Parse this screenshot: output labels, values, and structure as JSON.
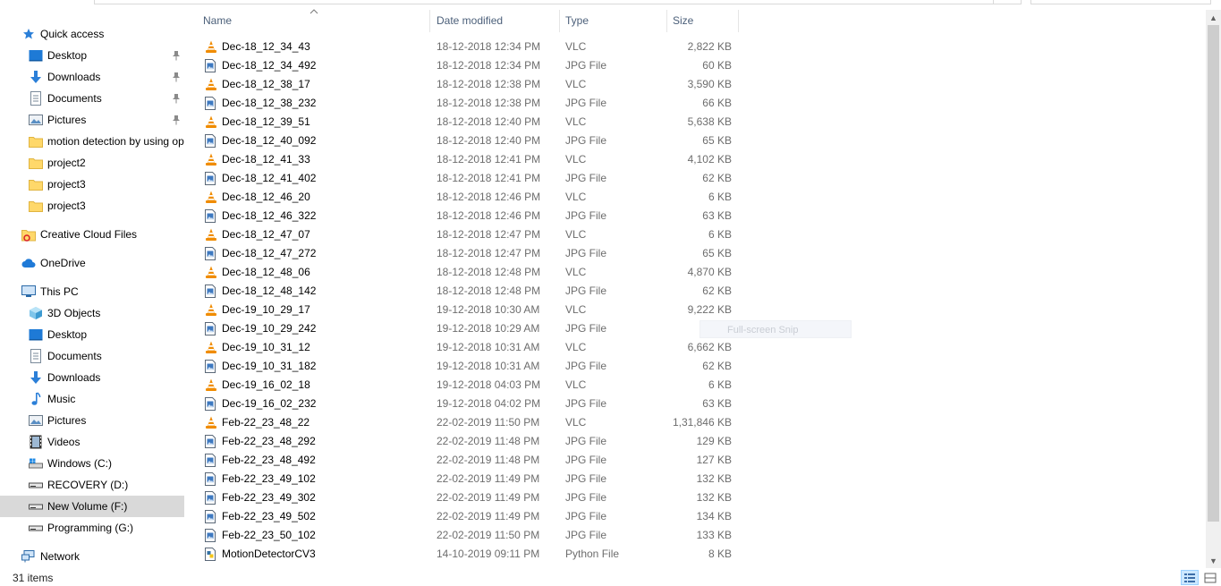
{
  "nav": {
    "items": [
      {
        "label": "Quick access",
        "icon": "star-icon",
        "level": 0
      },
      {
        "label": "Desktop",
        "icon": "desktop-icon",
        "level": 1,
        "pinned": true
      },
      {
        "label": "Downloads",
        "icon": "download-arrow-icon",
        "level": 1,
        "pinned": true
      },
      {
        "label": "Documents",
        "icon": "documents-icon",
        "level": 1,
        "pinned": true
      },
      {
        "label": "Pictures",
        "icon": "pictures-icon",
        "level": 1,
        "pinned": true
      },
      {
        "label": "motion detection by using opencv",
        "icon": "folder-icon",
        "level": 1
      },
      {
        "label": "project2",
        "icon": "folder-icon",
        "level": 1
      },
      {
        "label": "project3",
        "icon": "folder-icon",
        "level": 1
      },
      {
        "label": "project3",
        "icon": "folder-icon",
        "level": 1
      },
      {
        "label": "Creative Cloud Files",
        "icon": "creative-cloud-icon",
        "level": 0
      },
      {
        "label": "OneDrive",
        "icon": "cloud-icon",
        "level": 0
      },
      {
        "label": "This PC",
        "icon": "computer-icon",
        "level": 0
      },
      {
        "label": "3D Objects",
        "icon": "cube-icon",
        "level": 1
      },
      {
        "label": "Desktop",
        "icon": "desktop-icon",
        "level": 1
      },
      {
        "label": "Documents",
        "icon": "documents-icon",
        "level": 1
      },
      {
        "label": "Downloads",
        "icon": "download-arrow-icon",
        "level": 1
      },
      {
        "label": "Music",
        "icon": "music-note-icon",
        "level": 1
      },
      {
        "label": "Pictures",
        "icon": "pictures-icon",
        "level": 1
      },
      {
        "label": "Videos",
        "icon": "film-icon",
        "level": 1
      },
      {
        "label": "Windows (C:)",
        "icon": "windows-drive-icon",
        "level": 1
      },
      {
        "label": "RECOVERY (D:)",
        "icon": "drive-icon",
        "level": 1
      },
      {
        "label": "New Volume (F:)",
        "icon": "drive-icon",
        "level": 1,
        "selected": true
      },
      {
        "label": "Programming (G:)",
        "icon": "drive-icon",
        "level": 1
      },
      {
        "label": "Network",
        "icon": "network-icon",
        "level": 0
      }
    ]
  },
  "columns": {
    "name": "Name",
    "date": "Date modified",
    "type": "Type",
    "size": "Size"
  },
  "files": [
    {
      "name": "Dec-18_12_34_43",
      "date": "18-12-2018 12:34 PM",
      "type": "VLC",
      "size": "2,822 KB",
      "icon": "vlc-cone-icon"
    },
    {
      "name": "Dec-18_12_34_492",
      "date": "18-12-2018 12:34 PM",
      "type": "JPG File",
      "size": "60 KB",
      "icon": "image-file-icon"
    },
    {
      "name": "Dec-18_12_38_17",
      "date": "18-12-2018 12:38 PM",
      "type": "VLC",
      "size": "3,590 KB",
      "icon": "vlc-cone-icon"
    },
    {
      "name": "Dec-18_12_38_232",
      "date": "18-12-2018 12:38 PM",
      "type": "JPG File",
      "size": "66 KB",
      "icon": "image-file-icon"
    },
    {
      "name": "Dec-18_12_39_51",
      "date": "18-12-2018 12:40 PM",
      "type": "VLC",
      "size": "5,638 KB",
      "icon": "vlc-cone-icon"
    },
    {
      "name": "Dec-18_12_40_092",
      "date": "18-12-2018 12:40 PM",
      "type": "JPG File",
      "size": "65 KB",
      "icon": "image-file-icon"
    },
    {
      "name": "Dec-18_12_41_33",
      "date": "18-12-2018 12:41 PM",
      "type": "VLC",
      "size": "4,102 KB",
      "icon": "vlc-cone-icon"
    },
    {
      "name": "Dec-18_12_41_402",
      "date": "18-12-2018 12:41 PM",
      "type": "JPG File",
      "size": "62 KB",
      "icon": "image-file-icon"
    },
    {
      "name": "Dec-18_12_46_20",
      "date": "18-12-2018 12:46 PM",
      "type": "VLC",
      "size": "6 KB",
      "icon": "vlc-cone-icon"
    },
    {
      "name": "Dec-18_12_46_322",
      "date": "18-12-2018 12:46 PM",
      "type": "JPG File",
      "size": "63 KB",
      "icon": "image-file-icon"
    },
    {
      "name": "Dec-18_12_47_07",
      "date": "18-12-2018 12:47 PM",
      "type": "VLC",
      "size": "6 KB",
      "icon": "vlc-cone-icon"
    },
    {
      "name": "Dec-18_12_47_272",
      "date": "18-12-2018 12:47 PM",
      "type": "JPG File",
      "size": "65 KB",
      "icon": "image-file-icon"
    },
    {
      "name": "Dec-18_12_48_06",
      "date": "18-12-2018 12:48 PM",
      "type": "VLC",
      "size": "4,870 KB",
      "icon": "vlc-cone-icon"
    },
    {
      "name": "Dec-18_12_48_142",
      "date": "18-12-2018 12:48 PM",
      "type": "JPG File",
      "size": "62 KB",
      "icon": "image-file-icon"
    },
    {
      "name": "Dec-19_10_29_17",
      "date": "19-12-2018 10:30 AM",
      "type": "VLC",
      "size": "9,222 KB",
      "icon": "vlc-cone-icon"
    },
    {
      "name": "Dec-19_10_29_242",
      "date": "19-12-2018 10:29 AM",
      "type": "JPG File",
      "size": "64 KB",
      "icon": "image-file-icon"
    },
    {
      "name": "Dec-19_10_31_12",
      "date": "19-12-2018 10:31 AM",
      "type": "VLC",
      "size": "6,662 KB",
      "icon": "vlc-cone-icon"
    },
    {
      "name": "Dec-19_10_31_182",
      "date": "19-12-2018 10:31 AM",
      "type": "JPG File",
      "size": "62 KB",
      "icon": "image-file-icon"
    },
    {
      "name": "Dec-19_16_02_18",
      "date": "19-12-2018 04:03 PM",
      "type": "VLC",
      "size": "6 KB",
      "icon": "vlc-cone-icon"
    },
    {
      "name": "Dec-19_16_02_232",
      "date": "19-12-2018 04:02 PM",
      "type": "JPG File",
      "size": "63 KB",
      "icon": "image-file-icon"
    },
    {
      "name": "Feb-22_23_48_22",
      "date": "22-02-2019 11:50 PM",
      "type": "VLC",
      "size": "1,31,846 KB",
      "icon": "vlc-cone-icon"
    },
    {
      "name": "Feb-22_23_48_292",
      "date": "22-02-2019 11:48 PM",
      "type": "JPG File",
      "size": "129 KB",
      "icon": "image-file-icon"
    },
    {
      "name": "Feb-22_23_48_492",
      "date": "22-02-2019 11:48 PM",
      "type": "JPG File",
      "size": "127 KB",
      "icon": "image-file-icon"
    },
    {
      "name": "Feb-22_23_49_102",
      "date": "22-02-2019 11:49 PM",
      "type": "JPG File",
      "size": "132 KB",
      "icon": "image-file-icon"
    },
    {
      "name": "Feb-22_23_49_302",
      "date": "22-02-2019 11:49 PM",
      "type": "JPG File",
      "size": "132 KB",
      "icon": "image-file-icon"
    },
    {
      "name": "Feb-22_23_49_502",
      "date": "22-02-2019 11:49 PM",
      "type": "JPG File",
      "size": "134 KB",
      "icon": "image-file-icon"
    },
    {
      "name": "Feb-22_23_50_102",
      "date": "22-02-2019 11:50 PM",
      "type": "JPG File",
      "size": "133 KB",
      "icon": "image-file-icon"
    },
    {
      "name": "MotionDetectorCV3",
      "date": "14-10-2019 09:11 PM",
      "type": "Python File",
      "size": "8 KB",
      "icon": "python-file-icon"
    }
  ],
  "tooltip_ghost": "Full-screen Snip",
  "status": {
    "item_count": "31 items"
  },
  "colors": {
    "selected_nav": "#d9d9d9",
    "header_text": "#4c607a",
    "detail_text": "#6d6d6d",
    "vlc_orange": "#f08c00",
    "folder_yellow": "#ffd86a",
    "accent_blue": "#2b7fd8"
  }
}
